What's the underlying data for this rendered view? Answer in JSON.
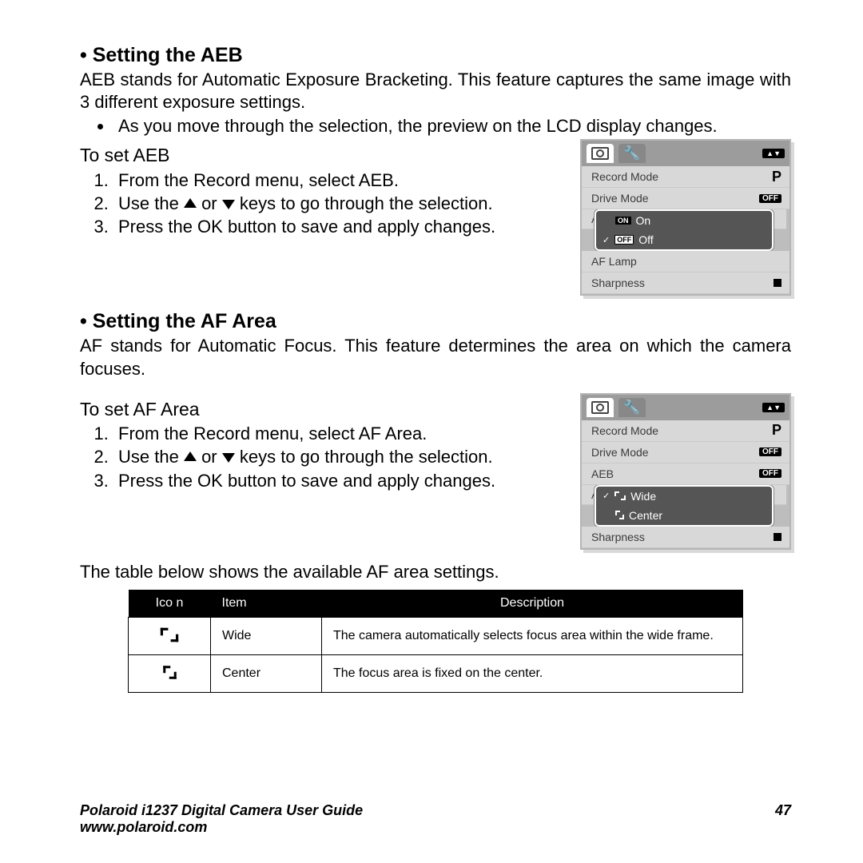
{
  "sections": {
    "aeb": {
      "title": "Setting the AEB",
      "intro": "AEB stands for Automatic Exposure Bracketing. This feature captures the same image with 3 different exposure settings.",
      "bullet": "As you move through the selection, the preview on the LCD display changes.",
      "subhead": "To set AEB",
      "steps": {
        "s1": "From the Record menu, select AEB.",
        "s2a": "Use the ",
        "s2b": " or ",
        "s2c": " keys to go through the selection.",
        "s3": "Press the OK button to save and apply changes."
      }
    },
    "af": {
      "title": "Setting the AF Area",
      "intro": "AF stands for Automatic Focus. This feature determines the area on which the camera focuses.",
      "subhead": "To set AF Area",
      "steps": {
        "s1": "From the Record menu, select AF Area.",
        "s2a": "Use the ",
        "s2b": " or ",
        "s2c": " keys to go through the selection.",
        "s3": "Press the OK button to save and apply changes."
      },
      "table_lead": "The table below shows the available AF area settings."
    }
  },
  "screen1": {
    "row1": {
      "l": "Record Mode",
      "r": "P"
    },
    "row2": {
      "l": "Drive Mode",
      "r": "OFF"
    },
    "popup": {
      "on": "On",
      "off": "Off",
      "on_badge": "ON",
      "off_badge": "OFF"
    },
    "row5": {
      "l": "AF Lamp"
    },
    "row6": {
      "l": "Sharpness"
    },
    "nav": "▲▼"
  },
  "screen2": {
    "row1": {
      "l": "Record Mode",
      "r": "P"
    },
    "row2": {
      "l": "Drive Mode",
      "r": "OFF"
    },
    "row3": {
      "l": "AEB",
      "r": "OFF"
    },
    "popup": {
      "wide": "Wide",
      "center": "Center"
    },
    "row6": {
      "l": "Sharpness"
    },
    "nav": "▲▼"
  },
  "table": {
    "h1": "Ico n",
    "h2": "Item",
    "h3": "Description",
    "r1": {
      "item": "Wide",
      "desc": "The camera automatically selects focus area within the wide frame."
    },
    "r2": {
      "item": "Center",
      "desc": "The focus area is fixed on the center."
    }
  },
  "footer": {
    "title": "Polaroid i1237 Digital Camera User Guide",
    "url": "www.polaroid.com",
    "page": "47"
  }
}
